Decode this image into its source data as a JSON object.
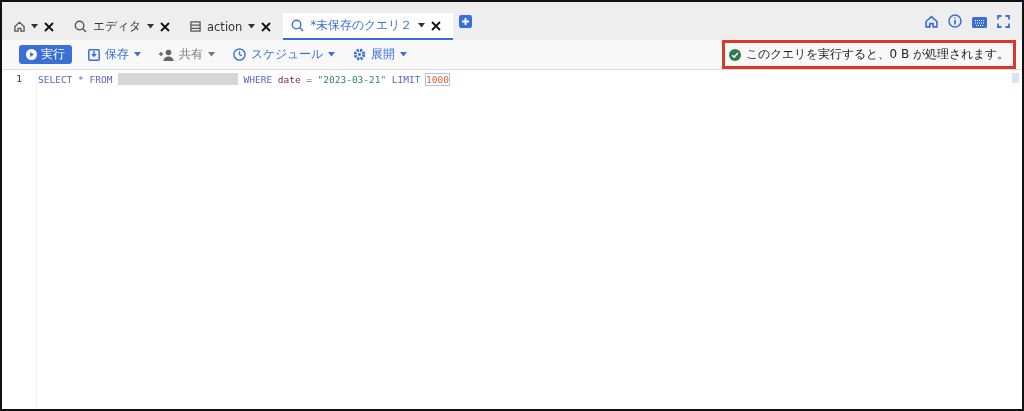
{
  "tabs": [
    {
      "kind": "home",
      "selected": false
    },
    {
      "kind": "query",
      "label": "エディタ",
      "selected": false
    },
    {
      "kind": "table",
      "label": "action",
      "selected": false
    },
    {
      "kind": "query",
      "label": "*未保存のクエリ２",
      "selected": true
    }
  ],
  "toolbar": [
    {
      "kind": "run",
      "label": "実行",
      "disabled": false
    },
    {
      "kind": "save",
      "label": "保存",
      "disabled": false
    },
    {
      "kind": "share",
      "label": "共有",
      "disabled": true
    },
    {
      "kind": "schedule",
      "label": "スケジュール",
      "disabled": false
    },
    {
      "kind": "deploy",
      "label": "展開",
      "disabled": false
    }
  ],
  "notice": {
    "text": "このクエリを実行すると、0 B が処理されます。",
    "highlighted": true
  },
  "editor": {
    "lines": [
      {
        "number": "1",
        "tokens": [
          {
            "kind": "keyword",
            "text": "SELECT * FROM"
          },
          {
            "kind": "redacted"
          },
          {
            "kind": "keyword",
            "text": "WHERE"
          },
          {
            "kind": "plain",
            "text": "date"
          },
          {
            "kind": "keyword",
            "text": "="
          },
          {
            "kind": "string",
            "text": "\"2023-03-21\""
          },
          {
            "kind": "keyword",
            "text": "LIMIT"
          },
          {
            "kind": "number",
            "text": "1000"
          }
        ]
      }
    ]
  }
}
